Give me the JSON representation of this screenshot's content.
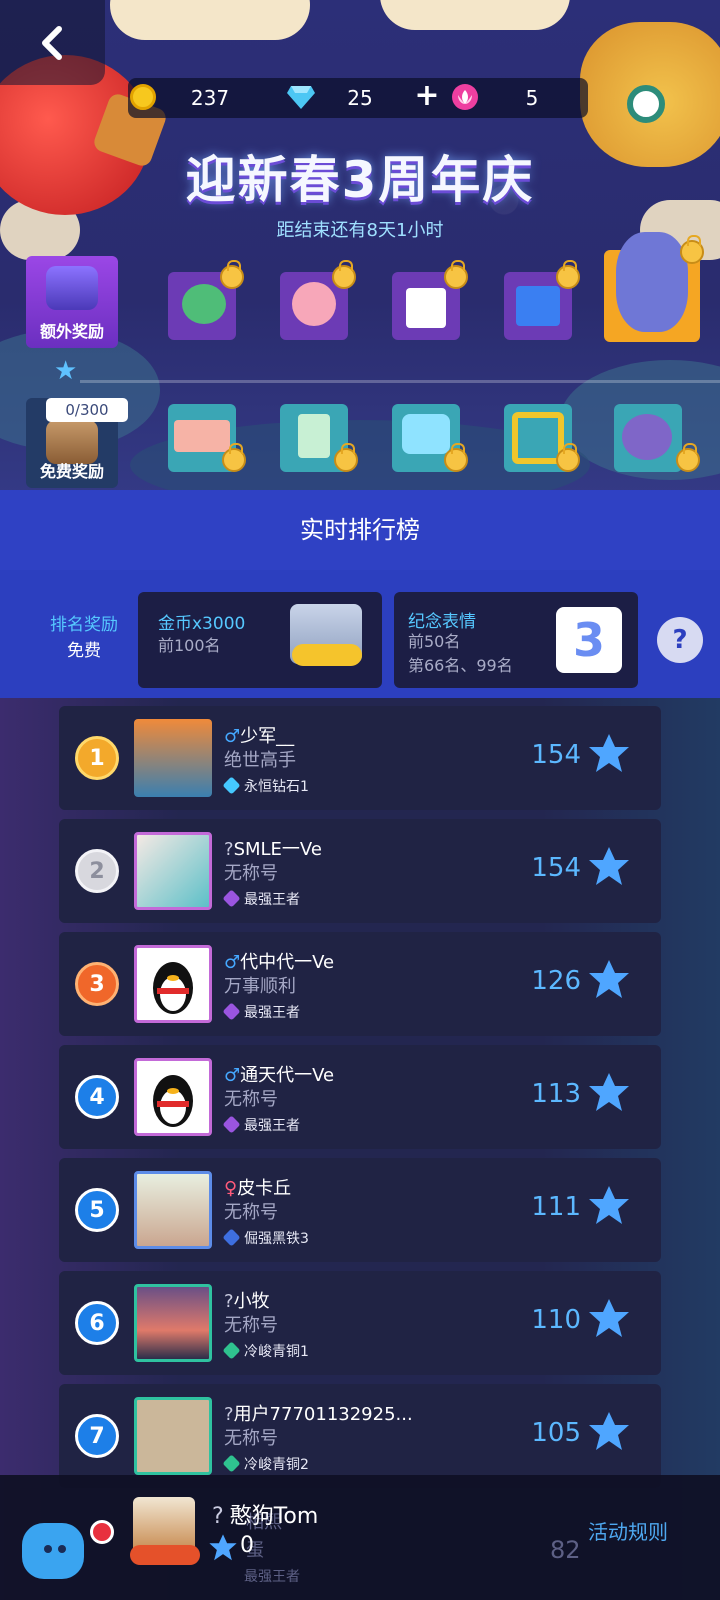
{
  "currency": {
    "gold": "237",
    "diamond": "25",
    "lotus": "5"
  },
  "event": {
    "title": "迎新春3周年庆",
    "countdown": "距结束还有8天1小时"
  },
  "rewards": {
    "extra_label": "额外奖励",
    "free_label": "免费奖励",
    "progress_text": "0/300"
  },
  "leaderboard": {
    "title": "实时排行榜",
    "rank_reward_title": "排名奖励",
    "rank_reward_sub": "免费",
    "cards": [
      {
        "title": "金币x3000",
        "sub": "前100名"
      },
      {
        "title": "纪念表情",
        "sub1": "前50名",
        "sub2": "第66名、99名"
      }
    ],
    "help_icon": "?",
    "rows": [
      {
        "rank": "1",
        "gender": "♂",
        "name": "少军__",
        "title": "绝世高手",
        "tier": "永恒钻石1",
        "score": "154"
      },
      {
        "rank": "2",
        "gender": "?",
        "name": "SMLE一Ve",
        "title": "无称号",
        "tier": "最强王者",
        "score": "154"
      },
      {
        "rank": "3",
        "gender": "♂",
        "name": "代中代一Ve",
        "title": "万事顺利",
        "tier": "最强王者",
        "score": "126"
      },
      {
        "rank": "4",
        "gender": "♂",
        "name": "通天代一Ve",
        "title": "无称号",
        "tier": "最强王者",
        "score": "113"
      },
      {
        "rank": "5",
        "gender": "♀",
        "name": "皮卡丘",
        "title": "无称号",
        "tier": "倔强黑铁3",
        "score": "111"
      },
      {
        "rank": "6",
        "gender": "?",
        "name": "小牧",
        "title": "无称号",
        "tier": "冷峻青铜1",
        "score": "110"
      },
      {
        "rank": "7",
        "gender": "?",
        "name": "用户77701132925...",
        "title": "无称号",
        "tier": "冷峻青铜2",
        "score": "105"
      }
    ],
    "partial_row": {
      "score": "82",
      "tier": "最强王者",
      "name_fragment": "相熙",
      "title_fragment": "蛋"
    }
  },
  "me": {
    "gender": "?",
    "name": "憨狗Tom",
    "score": "0"
  },
  "rules_link": "活动规则",
  "colors": {
    "accent_blue": "#2f41c4",
    "score_blue": "#5cb8ff",
    "title_cyan": "#56c8ff"
  },
  "icons": [
    "back-arrow-icon",
    "gold-coin-icon",
    "diamond-icon",
    "plus-icon",
    "lotus-icon",
    "lock-icon",
    "star-icon",
    "help-icon",
    "chest-icon",
    "mascot-icon"
  ]
}
